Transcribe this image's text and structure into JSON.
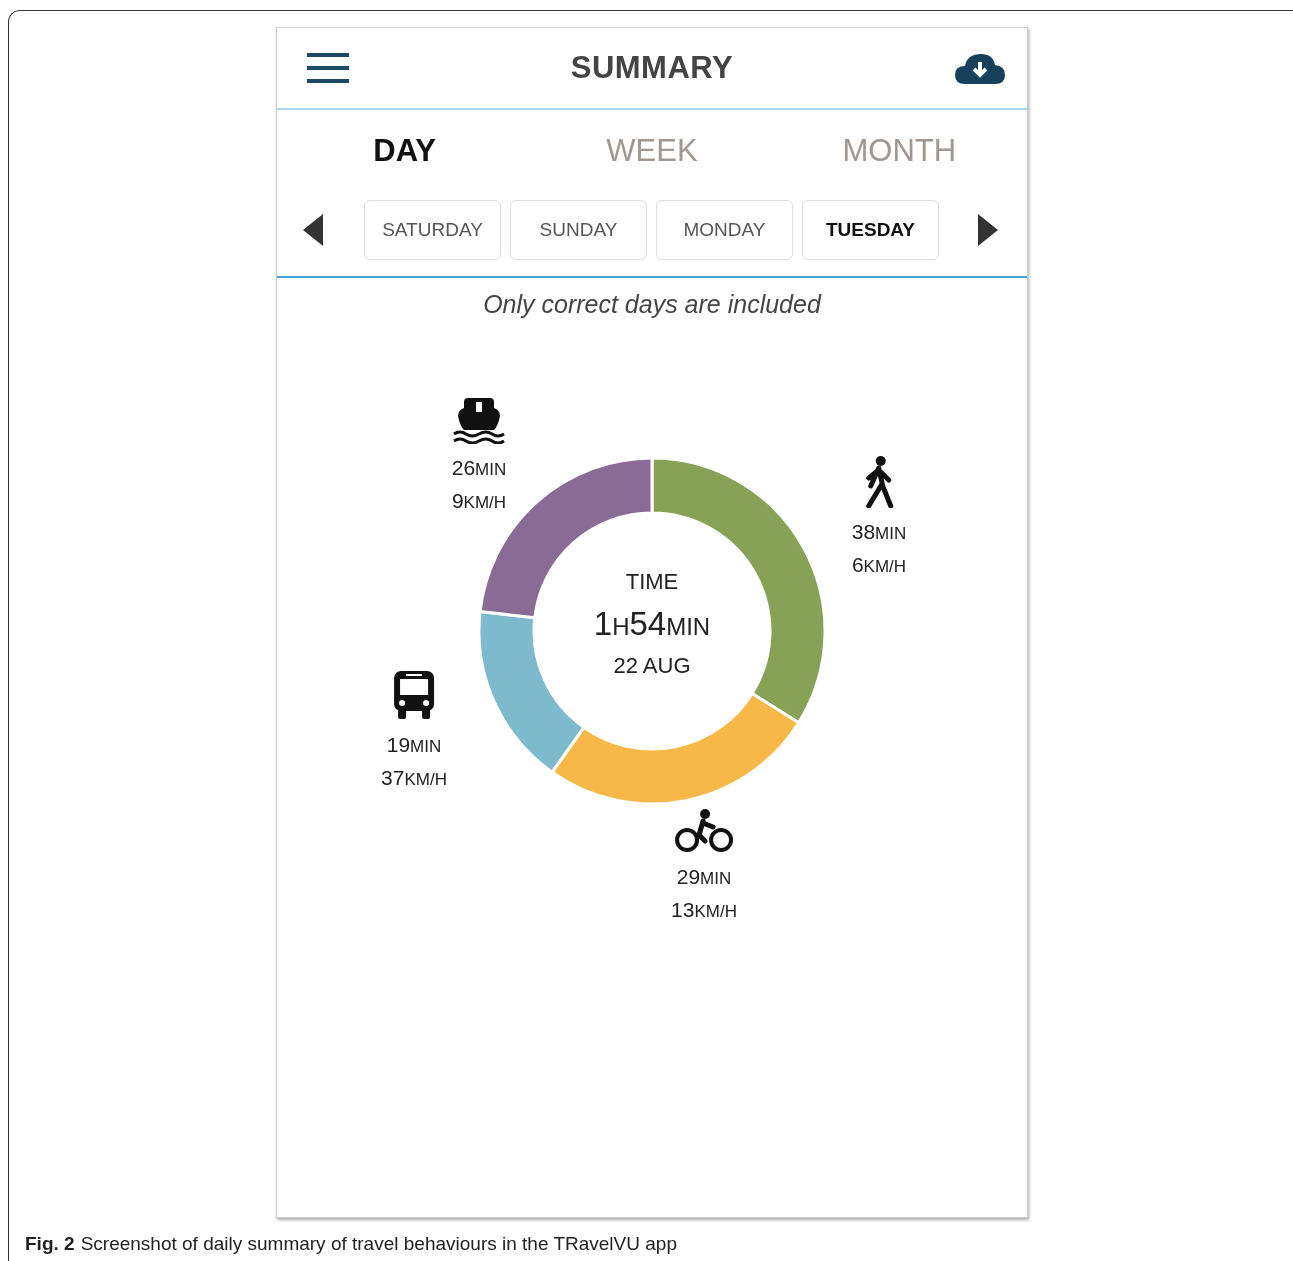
{
  "header": {
    "title": "SUMMARY"
  },
  "tabs": [
    {
      "label": "DAY",
      "selected": true
    },
    {
      "label": "WEEK",
      "selected": false
    },
    {
      "label": "MONTH",
      "selected": false
    }
  ],
  "days": [
    {
      "label": "SATURDAY",
      "selected": false
    },
    {
      "label": "SUNDAY",
      "selected": false
    },
    {
      "label": "MONDAY",
      "selected": false
    },
    {
      "label": "TUESDAY",
      "selected": true
    }
  ],
  "note": "Only correct days are included",
  "center": {
    "label": "TIME",
    "hours": "1",
    "hours_unit": "H",
    "minutes": "54",
    "minutes_unit": "MIN",
    "date": "22 AUG"
  },
  "modes": [
    {
      "kind": "walk",
      "time": "38",
      "time_unit": "MIN",
      "speed": "6",
      "speed_unit": "KM/H",
      "color": "#87a257"
    },
    {
      "kind": "bike",
      "time": "29",
      "time_unit": "MIN",
      "speed": "13",
      "speed_unit": "KM/H",
      "color": "#f7b847"
    },
    {
      "kind": "bus",
      "time": "19",
      "time_unit": "MIN",
      "speed": "37",
      "speed_unit": "KM/H",
      "color": "#7dbace"
    },
    {
      "kind": "boat",
      "time": "26",
      "time_unit": "MIN",
      "speed": "9",
      "speed_unit": "KM/H",
      "color": "#8a6b96"
    }
  ],
  "chart_data": {
    "type": "donut",
    "values": [
      33.9,
      25.9,
      17.0,
      23.2
    ]
  },
  "caption": {
    "label": "Fig. 2",
    "text": "Screenshot of daily summary of travel behaviours in the TRavelVU app"
  }
}
